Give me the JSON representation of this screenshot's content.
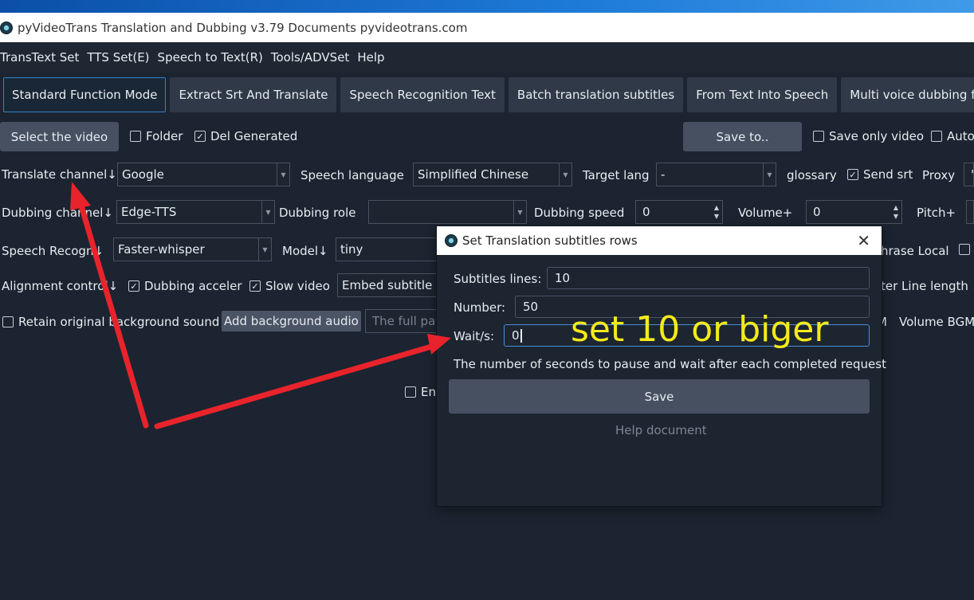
{
  "window": {
    "title": "pyVideoTrans Translation and Dubbing v3.79  Documents  pyvideotrans.com"
  },
  "menu": [
    "TransText Set",
    "TTS Set(E)",
    "Speech to Text(R)",
    "Tools/ADVSet",
    "Help"
  ],
  "tabs": [
    {
      "label": "Standard Function Mode",
      "active": true
    },
    {
      "label": "Extract Srt And Translate"
    },
    {
      "label": "Speech Recognition Text"
    },
    {
      "label": "Batch translation subtitles"
    },
    {
      "label": "From  Text  Into  Speech"
    },
    {
      "label": "Multi voice dubbing for SRT"
    }
  ],
  "row1": {
    "select_video": "Select the video",
    "folder": "Folder",
    "del_generated": "Del Generated",
    "save_to": "Save to..",
    "save_only_video": "Save only video",
    "auto": "Auto"
  },
  "row2": {
    "translate_channel": "Translate channel↓",
    "translate_value": "Google",
    "speech_language": "Speech language",
    "speech_language_value": "Simplified Chinese",
    "target_lang": "Target lang",
    "target_lang_value": "-",
    "glossary": "glossary",
    "send_srt": "Send srt",
    "proxy": "Proxy",
    "proxy_value": "'"
  },
  "row3": {
    "dubbing_channel": "Dubbing channel↓",
    "dubbing_value": "Edge-TTS",
    "dubbing_role": "Dubbing role",
    "dubbing_role_value": "",
    "dubbing_speed": "Dubbing speed",
    "dubbing_speed_value": "0",
    "volume": "Volume+",
    "volume_value": "0",
    "pitch": "Pitch+"
  },
  "row4": {
    "speech_recognition": "Speech Recogn↓",
    "recognition_value": "Faster-whisper",
    "model": "Model↓",
    "model_value": "tiny",
    "phrase_local": "hrase Local"
  },
  "row5": {
    "alignment_control": "Alignment control↓",
    "dubbing_accel": "Dubbing acceler",
    "slow_video": "Slow video",
    "embed_subtitle": "Embed subtitle",
    "line_length": "ter Line length"
  },
  "row6": {
    "retain_bg": "Retain original background sound",
    "add_bg_audio": "Add background audio",
    "full_path_placeholder": "The full pat",
    "m_label": "M",
    "volume_bgm": "Volume BGM"
  },
  "row7": {
    "enable_label": "Ena"
  },
  "dialog": {
    "title": "Set Translation subtitles rows",
    "subtitles_lines_label": "Subtitles lines:",
    "subtitles_lines_value": "10",
    "number_label": "Number:",
    "number_value": "50",
    "wait_label": "Wait/s:",
    "wait_value": "0",
    "hint": "The number of seconds to pause and wait after each completed request",
    "save": "Save",
    "help": "Help document"
  },
  "annotation": {
    "text": "set 10 or biger",
    "color": "#f5ea1a",
    "arrow_color": "#e8232b"
  }
}
